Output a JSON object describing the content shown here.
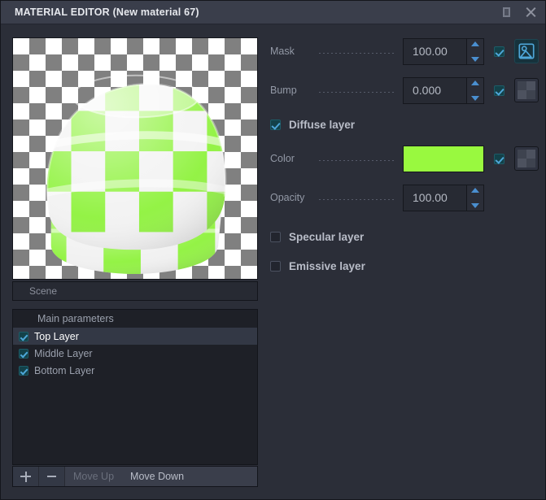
{
  "window": {
    "title": "MATERIAL EDITOR (New material 67)",
    "restore_icon": "restore-icon",
    "close_icon": "close-icon"
  },
  "preview": {
    "scene_label": "Scene",
    "background": "checkerboard-transparency",
    "object_colors": {
      "green": "#8ef23c",
      "white": "#f2f2f2"
    }
  },
  "params": {
    "mask": {
      "label": "Mask",
      "value": "100.00",
      "enabled": true,
      "texture_icon": "image-icon",
      "texture_active": true
    },
    "bump": {
      "label": "Bump",
      "value": "0.000",
      "enabled": true,
      "texture_icon": "checkerboard-icon",
      "texture_active": false
    },
    "diffuse_layer": {
      "label": "Diffuse layer",
      "checked": true
    },
    "color": {
      "label": "Color",
      "value": "#99f93f",
      "enabled": true,
      "texture_icon": "checkerboard-icon",
      "texture_active": false
    },
    "opacity": {
      "label": "Opacity",
      "value": "100.00"
    },
    "specular_layer": {
      "label": "Specular layer",
      "checked": false
    },
    "emissive_layer": {
      "label": "Emissive layer",
      "checked": false
    }
  },
  "layers_panel": {
    "header": "Main parameters",
    "rows": [
      {
        "label": "Top Layer",
        "checked": true,
        "selected": true
      },
      {
        "label": "Middle Layer",
        "checked": true,
        "selected": false
      },
      {
        "label": "Bottom Layer",
        "checked": true,
        "selected": false
      }
    ],
    "toolbar": {
      "add_label": "+",
      "remove_label": "−",
      "move_up_label": "Move Up",
      "move_down_label": "Move Down",
      "move_up_enabled": false,
      "move_down_enabled": true
    }
  },
  "colors": {
    "accent_teal": "#134149",
    "accent_blue": "#4a8fd0",
    "titlebar_bg": "#3a3e4b",
    "window_bg": "#2b2e38",
    "panel_bg": "#1e2027"
  }
}
